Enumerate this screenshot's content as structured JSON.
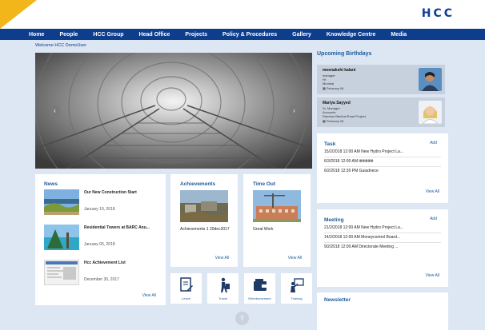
{
  "header": {
    "logo": "HCC",
    "nav": [
      "Home",
      "People",
      "HCC Group",
      "Head Office",
      "Projects",
      "Policy & Procedures",
      "Gallery",
      "Knowledge Centre",
      "Media"
    ]
  },
  "welcome": "Welcome HCC DemoUser",
  "hero": {
    "prev_icon": "‹",
    "next_icon": "›"
  },
  "news": {
    "title": "News",
    "items": [
      {
        "title": "Our New Construction Start",
        "date": "January 19, 2018"
      },
      {
        "title": "Residential Towers at BARC Anu...",
        "date": "January 06, 2018"
      },
      {
        "title": "Hcc Achievement List",
        "date": "December 30, 2017"
      }
    ],
    "view_all": "View All"
  },
  "achievements": {
    "title": "Achievements",
    "label": "Achievements 1 20dec2017",
    "view_all": "View All"
  },
  "timeout": {
    "title": "Time Out",
    "label": "Great Work",
    "view_all": "View All"
  },
  "quick_links": [
    "Leave",
    "Travel",
    "Reimbursement",
    "Training"
  ],
  "birthdays": {
    "title": "Upcoming Birthdays",
    "people": [
      {
        "name": "meenakshi kalani",
        "role": "manager",
        "dept": "Hr",
        "location": "Mumbai",
        "date": "February 06"
      },
      {
        "name": "Mariya Sayyed",
        "role": "Sr. Manager",
        "dept": "Accounts",
        "location": "Ramban Banihal Road Project",
        "date": "February 06"
      }
    ]
  },
  "task": {
    "title": "Task",
    "add": "Add",
    "rows": [
      "15/2/2018  12:00 AM  New Hydro Project La...",
      "6/3/2018  12:00 AM  ttttttttttttt",
      "6/2/2018  12:30 PM  Guiadnece"
    ],
    "view_all": "View All"
  },
  "meeting": {
    "title": "Meeting",
    "add": "Add",
    "rows": [
      "21/2/2018  12:00 AM  New Hydro Project La...",
      "14/2/2018  12:00 AM  Moneycontrol Board...",
      "9/2/2018  12:00 AM  Directorate Meeting ..."
    ],
    "view_all": "View All"
  },
  "newsletter": {
    "title": "Newsletter"
  },
  "colors": {
    "nav": "#0e3d8c",
    "accent": "#1b5a9e",
    "corner": "#f2b61b",
    "page_bg": "#dde6f3"
  },
  "icons": {
    "scroll_up": "⇧"
  }
}
